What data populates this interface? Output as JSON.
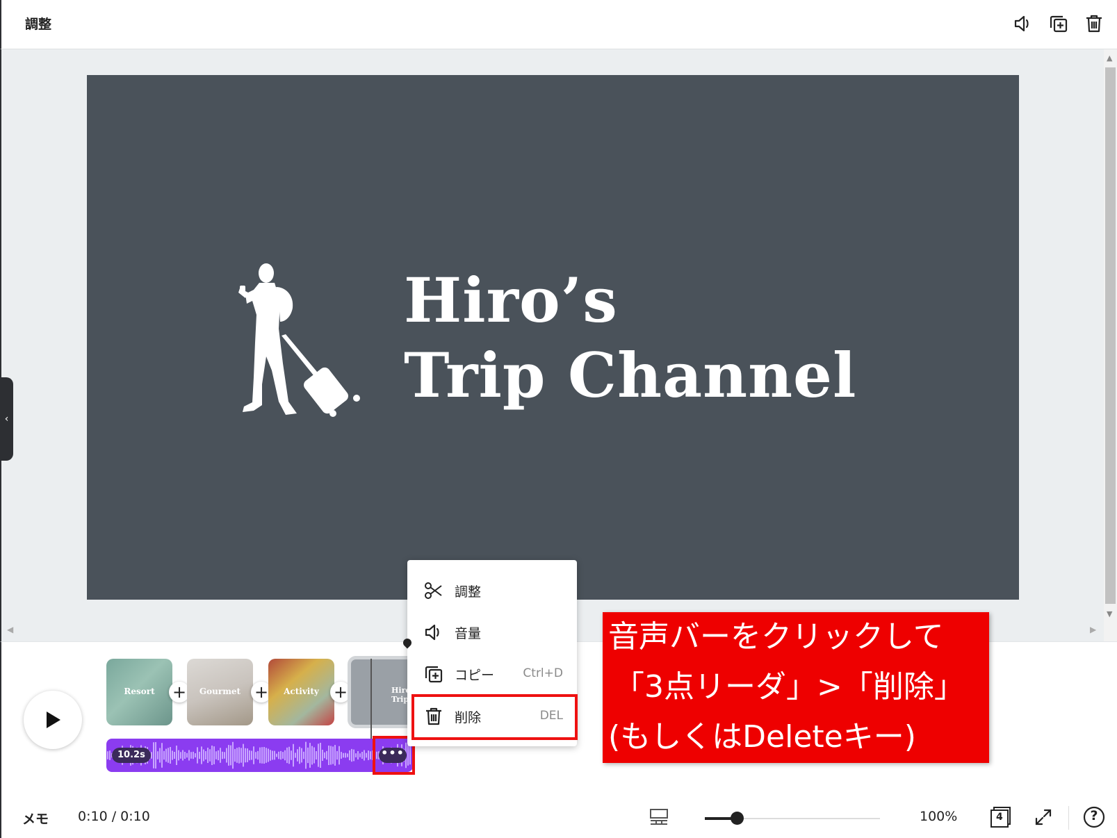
{
  "toolbar": {
    "title": "調整",
    "icons": [
      "volume-icon",
      "copy-icon",
      "trash-icon"
    ]
  },
  "canvas": {
    "background": "#4a525a",
    "logo_line1": "Hiro’s",
    "logo_line2": "Trip Channel"
  },
  "timeline": {
    "clips": [
      {
        "label": "Resort"
      },
      {
        "label": "Gourmet"
      },
      {
        "label": "Activity"
      },
      {
        "label": "Hiro’s Trip"
      }
    ],
    "audio": {
      "duration": "10.2s",
      "more_label": "•••",
      "color": "#8b3cf0"
    }
  },
  "context_menu": {
    "items": [
      {
        "label": "調整",
        "shortcut": "",
        "icon": "scissors-icon"
      },
      {
        "label": "音量",
        "shortcut": "",
        "icon": "volume-icon"
      },
      {
        "label": "コピー",
        "shortcut": "Ctrl+D",
        "icon": "copy-icon"
      },
      {
        "label": "削除",
        "shortcut": "DEL",
        "icon": "trash-icon"
      }
    ]
  },
  "annotation": {
    "line1": "音声バーをクリックして",
    "line2": "「3点リーダ」>「削除」",
    "line3": "(もしくはDeleteキー)",
    "color": "#ee0000"
  },
  "statusbar": {
    "memo": "メモ",
    "time": "0:10 / 0:10",
    "zoom": "100%",
    "page_count": "4",
    "help": "?"
  }
}
